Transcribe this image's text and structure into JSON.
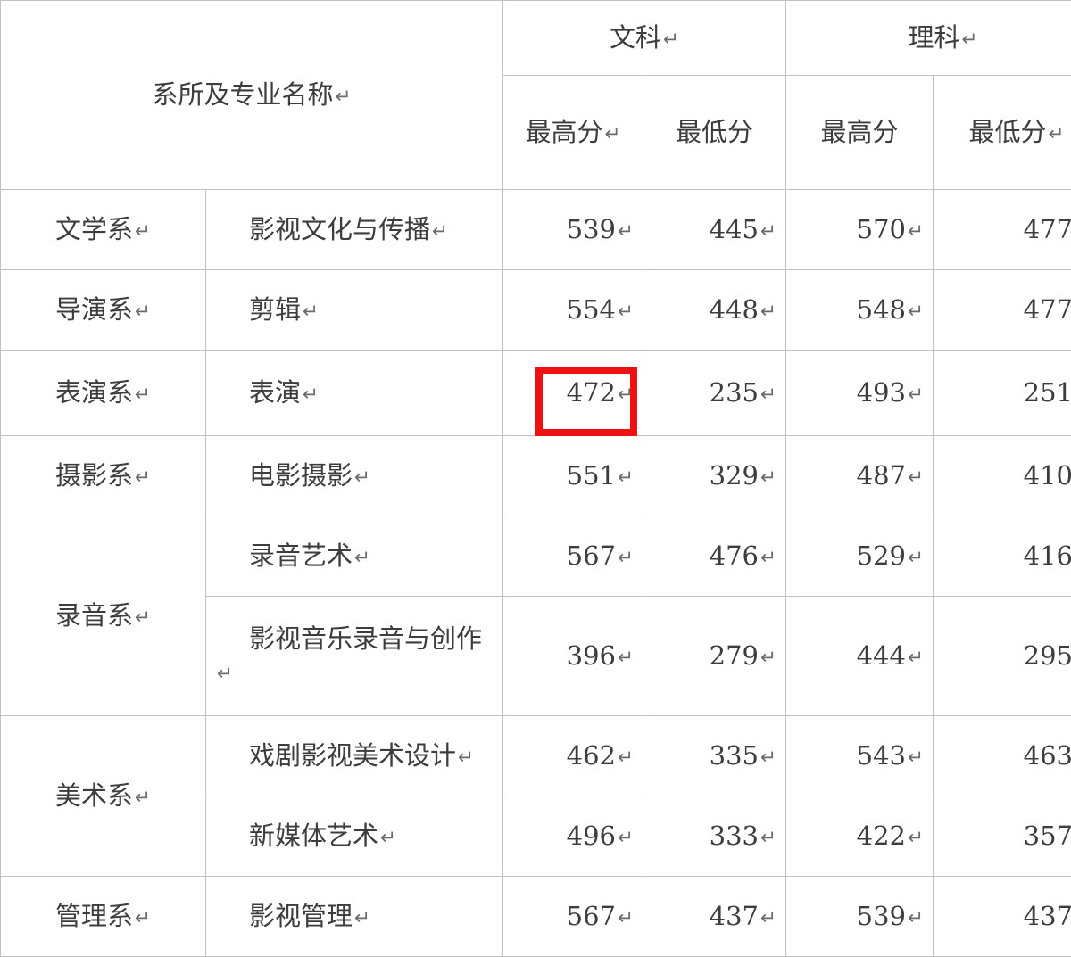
{
  "table": {
    "return_mark": "↵",
    "headers": {
      "name_col": "系所及专业名称",
      "groups": [
        {
          "label": "文科"
        },
        {
          "label": "理科"
        }
      ],
      "sub": [
        "最高分",
        "最低分",
        "最高分",
        "最低分"
      ]
    },
    "rows": [
      {
        "dept": "文学系",
        "major": "影视文化与传播",
        "liberal_high": "539",
        "liberal_low": "445",
        "science_high": "570",
        "science_low": "477"
      },
      {
        "dept": "导演系",
        "major": "剪辑",
        "liberal_high": "554",
        "liberal_low": "448",
        "science_high": "548",
        "science_low": "477"
      },
      {
        "dept": "表演系",
        "major": "表演",
        "liberal_high": "472",
        "liberal_low": "235",
        "science_high": "493",
        "science_low": "251"
      },
      {
        "dept": "摄影系",
        "major": "电影摄影",
        "liberal_high": "551",
        "liberal_low": "329",
        "science_high": "487",
        "science_low": "410"
      },
      {
        "dept": "录音系",
        "major": "录音艺术",
        "liberal_high": "567",
        "liberal_low": "476",
        "science_high": "529",
        "science_low": "416"
      },
      {
        "dept": "",
        "major": "影视音乐录音与创作",
        "liberal_high": "396",
        "liberal_low": "279",
        "science_high": "444",
        "science_low": "295"
      },
      {
        "dept": "美术系",
        "major": "戏剧影视美术设计",
        "liberal_high": "462",
        "liberal_low": "335",
        "science_high": "543",
        "science_low": "463"
      },
      {
        "dept": "",
        "major": "新媒体艺术",
        "liberal_high": "496",
        "liberal_low": "333",
        "science_high": "422",
        "science_low": "357"
      },
      {
        "dept": "管理系",
        "major": "影视管理",
        "liberal_high": "567",
        "liberal_low": "437",
        "science_high": "539",
        "science_low": "437"
      }
    ]
  },
  "annotation": {
    "highlight_color": "#ee1111",
    "highlighted_value": "472"
  }
}
